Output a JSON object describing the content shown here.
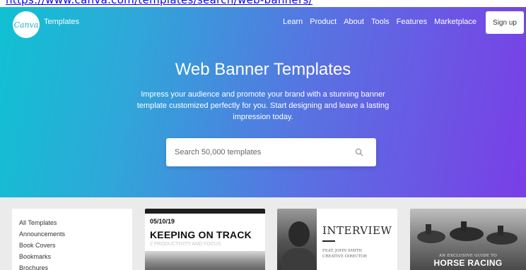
{
  "top_link": {
    "text": "https://www.canva.com/templates/search/web-banners/"
  },
  "header": {
    "logo_text": "Canva",
    "section_label": "Templates",
    "nav": [
      "Learn",
      "Product",
      "About",
      "Tools",
      "Features",
      "Marketplace"
    ],
    "signup_label": "Sign up"
  },
  "hero": {
    "title": "Web Banner Templates",
    "subtitle": "Impress your audience and promote your brand with a stunning banner template customized perfectly for you. Start designing and leave a lasting impression today."
  },
  "search": {
    "placeholder": "Search 50,000 templates",
    "value": "",
    "icon": "search-icon"
  },
  "sidebar": {
    "items": [
      "All Templates",
      "Announcements",
      "Book Covers",
      "Bookmarks",
      "Brochures"
    ]
  },
  "cards": [
    {
      "date": "05/10/19",
      "headline": "KEEPING ON TRACK",
      "subline": "// PRODUCTIVITY AND FOCUS"
    },
    {
      "title": "INTERVIEW",
      "credit_lines": [
        "FEAT. JOHN SMITH",
        "CREATIVE DIRECTOR"
      ]
    },
    {
      "guide": "AN EXCLUSIVE GUIDE TO",
      "headline": "HORSE RACING"
    }
  ],
  "colors": {
    "gradient_start": "#10c1d3",
    "gradient_end": "#7a3ee6",
    "background": "#ebebeb",
    "link": "#0a00ee"
  }
}
